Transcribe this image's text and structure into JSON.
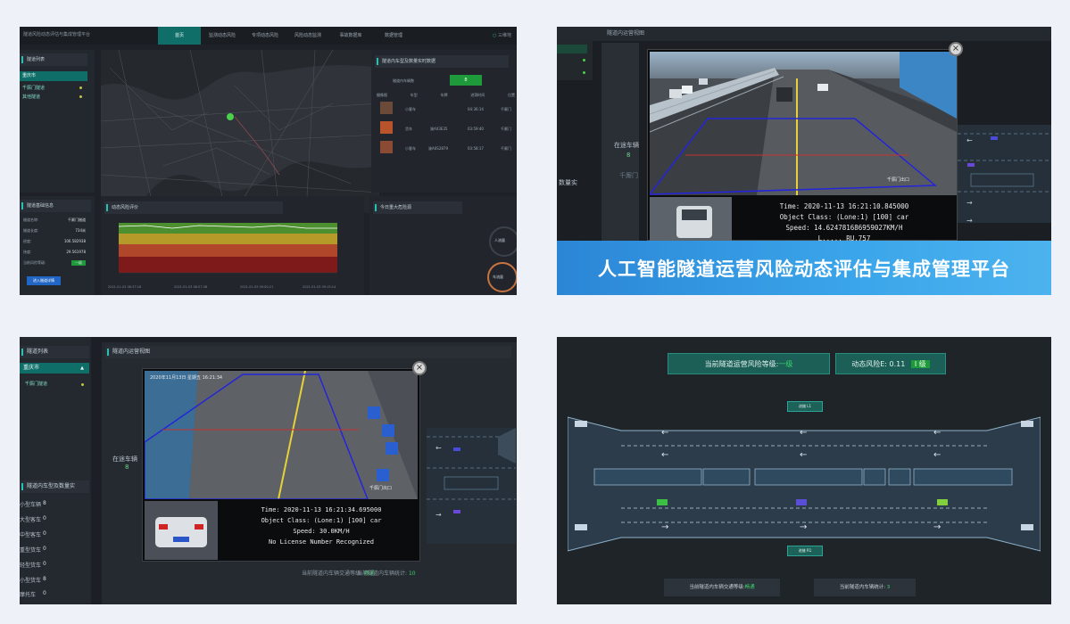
{
  "panel_dashboard": {
    "app_title": "隧道风险动态评估与集成管理平台",
    "tabs": [
      "首页",
      "监测动态风险",
      "专项动态风险",
      "风险动态监测",
      "事故数据库",
      "数据管理"
    ],
    "active_tab": 0,
    "user_label": "三维地",
    "tunnel_list": {
      "title": "隧道列表",
      "selected": "重庆市",
      "items": [
        "千厮门隧道",
        "其他隧道"
      ]
    },
    "vehicle_panel": {
      "title": "隧道内车型及数量实时数据",
      "left_label": "隧道内车辆数",
      "count": "8",
      "columns": [
        "摄像图",
        "车型",
        "车牌",
        "进洞时间",
        "位置"
      ],
      "rows": [
        {
          "type": "小客车",
          "plate": "",
          "time": "04:36:14",
          "pos": "千厮门"
        },
        {
          "type": "货车",
          "plate": "渝A03E35",
          "time": "03:59:40",
          "pos": "千厮门"
        },
        {
          "type": "小客车",
          "plate": "渝A0S2879",
          "time": "03:58:17",
          "pos": "千厮门"
        }
      ]
    },
    "basic_info": {
      "title": "隧道基础信息",
      "items": [
        {
          "k": "隧道名称:",
          "v": "千厮门隧道"
        },
        {
          "k": "隧道长度:",
          "v": "734米"
        },
        {
          "k": "经度:",
          "v": "106.582938"
        },
        {
          "k": "纬度:",
          "v": "29.561978"
        },
        {
          "k": "当前风险等级:",
          "v": "一级"
        }
      ],
      "button": "进入隧道详情"
    },
    "risk_chart": {
      "title": "动态风险评价",
      "x_labels": [
        "2021-01-03 08:37:18",
        "2021-01-03 08:57:38",
        "2021-01-03 09:00:21",
        "2021-01-03 09:15:14"
      ]
    },
    "incident_panel": {
      "title": "今日重大危险源",
      "gauge1": "人流量",
      "gauge2": "车流量"
    }
  },
  "panel_camera_top": {
    "header": "隧道内运营视图",
    "side_count_label": "在途车辆",
    "side_count": "8",
    "side_section": "数量实",
    "side_gate": "千厮门",
    "detection": {
      "time": "Time: 2020-11-13 16:21:10.845000",
      "object": "Object Class: (Lone:1) [100] car",
      "speed": "Speed: 14.624781686959027KM/H",
      "extra": "L..... RU.757"
    },
    "watermark": "千厮门出口",
    "banner": "人工智能隧道运营风险动态评估与集成管理平台"
  },
  "panel_camera_bottom": {
    "list_title": "隧道列表",
    "city": "重庆市",
    "tunnel": "千厮门隧道",
    "header": "隧道内运营视图",
    "side_count_label": "在途车辆",
    "side_count": "8",
    "vehicle_section": "隧道内车型及数量实",
    "vehicle_types": [
      {
        "name": "小型车辆",
        "count": "8"
      },
      {
        "name": "大型客车",
        "count": "0"
      },
      {
        "name": "中型客车",
        "count": "0"
      },
      {
        "name": "重型货车",
        "count": "0"
      },
      {
        "name": "轻型货车",
        "count": "0"
      },
      {
        "name": "小型货车",
        "count": "8"
      },
      {
        "name": "摩托车",
        "count": "0"
      }
    ],
    "detection": {
      "time": "Time: 2020-11-13 16:21:34.695000",
      "object": "Object Class: (Lone:1) [100] car",
      "speed": "Speed: 30.0KM/H",
      "plate": "No License Number Recognized"
    },
    "overlay_date": "2020年11月13日 星期五 16:21:34",
    "watermark": "千厮门出口",
    "traffic_level_label": "当前隧道内车辆交通等级:",
    "traffic_level": "畅通",
    "vehicle_count_label": "当前隧道内车辆统计:",
    "vehicle_count": "10"
  },
  "panel_tunnel_map": {
    "risk_level_label": "当前隧道运营风险等级:",
    "risk_level": "一级",
    "dynamic_risk_label": "动态风险E: 0.11",
    "dynamic_risk_grade": "I 级",
    "entrance_label": "进隧 L1",
    "exit_label": "进隧 R1",
    "traffic_level_label": "当前隧道内车辆交通等级:",
    "traffic_level": "畅通",
    "vehicle_count_label": "当前隧道内车辆统计:",
    "vehicle_count": "3",
    "colors": {
      "accent": "#27c1b4",
      "badge": "#1c5f57",
      "level_green": "#39d36b"
    }
  }
}
